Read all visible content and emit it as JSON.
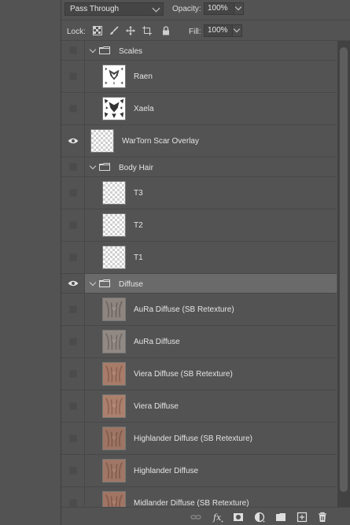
{
  "blend_mode": {
    "value": "Pass Through"
  },
  "opacity": {
    "label": "Opacity:",
    "value": "100%"
  },
  "lock": {
    "label": "Lock:"
  },
  "fill": {
    "label": "Fill:",
    "value": "100%"
  },
  "layers": [
    {
      "name": "Scales",
      "kind": "group",
      "visible": false,
      "expanded": true
    },
    {
      "name": "Raen",
      "kind": "layer",
      "visible": false,
      "thumb": "scale-pattern"
    },
    {
      "name": "Xaela",
      "kind": "layer",
      "visible": false,
      "thumb": "scale-pattern"
    },
    {
      "name": "WarTorn Scar Overlay",
      "kind": "layer",
      "visible": true,
      "thumb": "transparent"
    },
    {
      "name": "Body Hair",
      "kind": "group",
      "visible": false,
      "expanded": true
    },
    {
      "name": "T3",
      "kind": "layer",
      "visible": false,
      "thumb": "transparent"
    },
    {
      "name": "T2",
      "kind": "layer",
      "visible": false,
      "thumb": "transparent"
    },
    {
      "name": "T1",
      "kind": "layer",
      "visible": false,
      "thumb": "transparent"
    },
    {
      "name": "Diffuse",
      "kind": "group",
      "visible": true,
      "expanded": true,
      "selected": true
    },
    {
      "name": "AuRa Diffuse (SB Retexture)",
      "kind": "layer",
      "visible": false,
      "thumb": "skin-gray"
    },
    {
      "name": "AuRa Diffuse",
      "kind": "layer",
      "visible": false,
      "thumb": "skin-gray"
    },
    {
      "name": "Viera Diffuse (SB Retexture)",
      "kind": "layer",
      "visible": false,
      "thumb": "skin-tan"
    },
    {
      "name": "Viera Diffuse",
      "kind": "layer",
      "visible": false,
      "thumb": "skin-tan"
    },
    {
      "name": "Highlander Diffuse (SB Retexture)",
      "kind": "layer",
      "visible": false,
      "thumb": "skin-brown"
    },
    {
      "name": "Highlander Diffuse",
      "kind": "layer",
      "visible": false,
      "thumb": "skin-brown"
    },
    {
      "name": "Midlander Diffuse (SB Retexture)",
      "kind": "layer",
      "visible": false,
      "thumb": "skin-brown"
    }
  ],
  "bottom_icons": [
    "link-layers-icon",
    "fx-icon",
    "layer-mask-icon",
    "adjustment-layer-icon",
    "new-group-icon",
    "new-layer-icon",
    "trash-icon"
  ]
}
